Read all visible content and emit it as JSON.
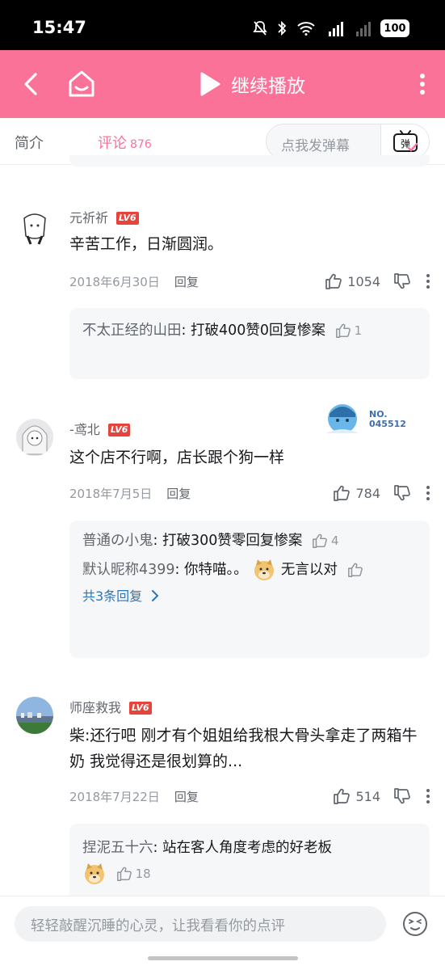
{
  "status_bar": {
    "time": "15:47",
    "battery": "100"
  },
  "header": {
    "continue_label": "继续播放"
  },
  "tabs": {
    "intro": "简介",
    "comments": "评论",
    "comment_count": "876"
  },
  "danmaku": {
    "placeholder": "点我发弹幕",
    "button": "弹"
  },
  "comments": [
    {
      "user": "元祈祈",
      "level": "LV6",
      "text": "辛苦工作，日渐圆润。",
      "date": "2018年6月30日",
      "reply": "回复",
      "likes": "1054",
      "replies": [
        {
          "user": "不太正经的山田",
          "text": "打破400赞0回复惨案",
          "likes": "1"
        }
      ]
    },
    {
      "user": "-鸢北",
      "level": "LV6",
      "badge_text": "NO.\n045512",
      "text": "这个店不行啊，店长跟个狗一样",
      "date": "2018年7月5日",
      "reply": "回复",
      "likes": "784",
      "replies": [
        {
          "user": "普通の小鬼",
          "text": "打破300赞零回复惨案",
          "likes": "4"
        },
        {
          "user": "默认昵称4399",
          "text_a": "你特喵。。",
          "text_b": "无言以对"
        }
      ],
      "total_replies": "共3条回复"
    },
    {
      "user": "师座救我",
      "level": "LV6",
      "text": "柴:还行吧 刚才有个姐姐给我根大骨头拿走了两箱牛奶 我觉得还是很划算的...",
      "date": "2018年7月22日",
      "reply": "回复",
      "likes": "514",
      "replies": [
        {
          "user": "捏泥五十六",
          "text": "站在客人角度考虑的好老板",
          "likes": "18"
        }
      ]
    }
  ],
  "bottom": {
    "placeholder": "轻轻敲醒沉睡的心灵，让我看看你的点评"
  },
  "colors": {
    "brand_pink": "#fb7299",
    "level_red": "#e5433c",
    "link_blue": "#2b75bb"
  }
}
